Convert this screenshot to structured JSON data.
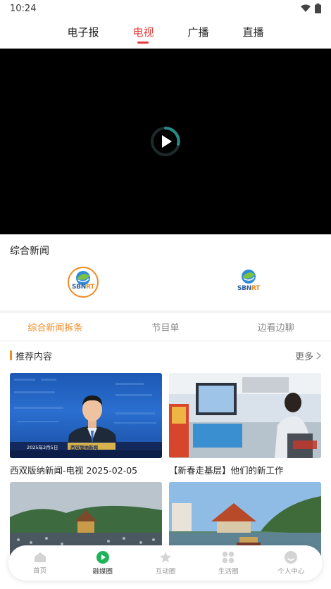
{
  "status": {
    "time": "10:24"
  },
  "top_tabs": [
    {
      "label": "电子报"
    },
    {
      "label": "电视"
    },
    {
      "label": "广播"
    },
    {
      "label": "直播"
    }
  ],
  "player": {
    "state": "paused"
  },
  "channels": {
    "title": "综合新闻",
    "logos": [
      {
        "name": "SBNRT",
        "selected": true
      },
      {
        "name": "SBNRT",
        "selected": false
      }
    ],
    "logo_text_main": "SBN",
    "logo_text_accent": "RT"
  },
  "sub_tabs": [
    {
      "label": "综合新闻拆条"
    },
    {
      "label": "节目单"
    },
    {
      "label": "边看边聊"
    }
  ],
  "recommend": {
    "title": "推荐内容",
    "more_label": "更多"
  },
  "cards": [
    {
      "title": "西双版纳新闻-电视 2025-02-05",
      "thumb_caption": "西双版纳新闻",
      "thumb_date": "2025年2月5日",
      "thumb_kind": "news"
    },
    {
      "title": "【新春走基层】他们的新工作",
      "thumb_kind": "office"
    },
    {
      "title": "",
      "thumb_kind": "crowd"
    },
    {
      "title": "",
      "thumb_kind": "lake"
    }
  ],
  "bottom_nav": [
    {
      "label": "首页",
      "icon": "home-icon"
    },
    {
      "label": "融媒圈",
      "icon": "play-circle-icon"
    },
    {
      "label": "互动圈",
      "icon": "star-icon"
    },
    {
      "label": "生活圈",
      "icon": "grid-icon"
    },
    {
      "label": "个人中心",
      "icon": "user-icon"
    }
  ],
  "colors": {
    "accent": "#f08a24",
    "active_tab": "#e63c3c",
    "nav_active": "#1fb35a"
  }
}
